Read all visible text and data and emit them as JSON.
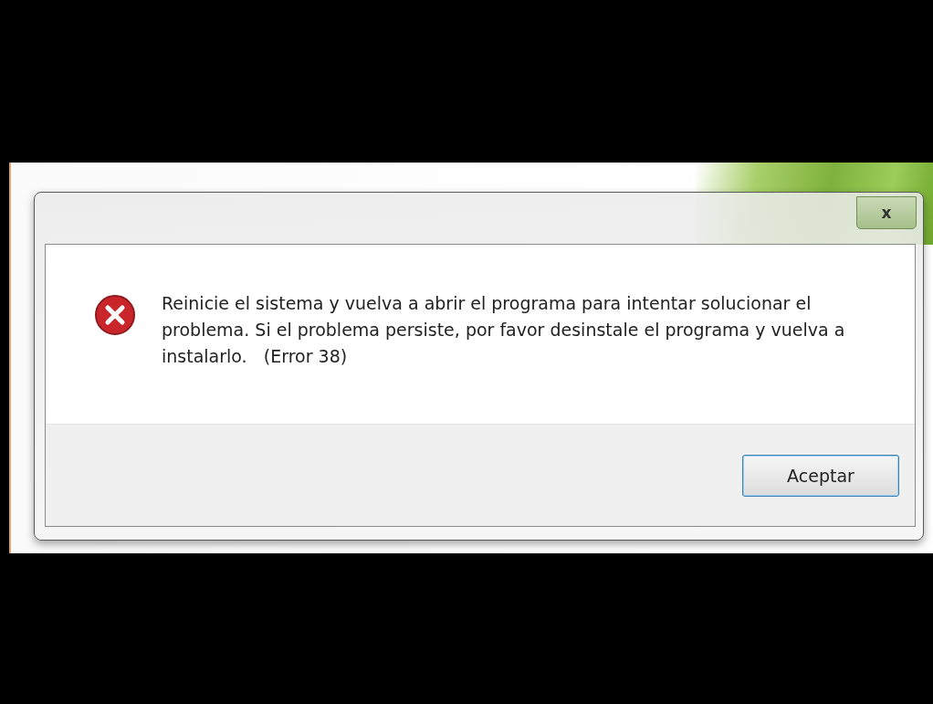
{
  "dialog": {
    "close_label": "x",
    "message": "Reinicie el sistema y vuelva a abrir el programa para intentar solucionar el problema. Si el problema persiste, por favor desinstale el programa y vuelva a instalarlo.   (Error 38)",
    "buttons": [
      {
        "label": "Aceptar",
        "selected": true
      }
    ]
  }
}
